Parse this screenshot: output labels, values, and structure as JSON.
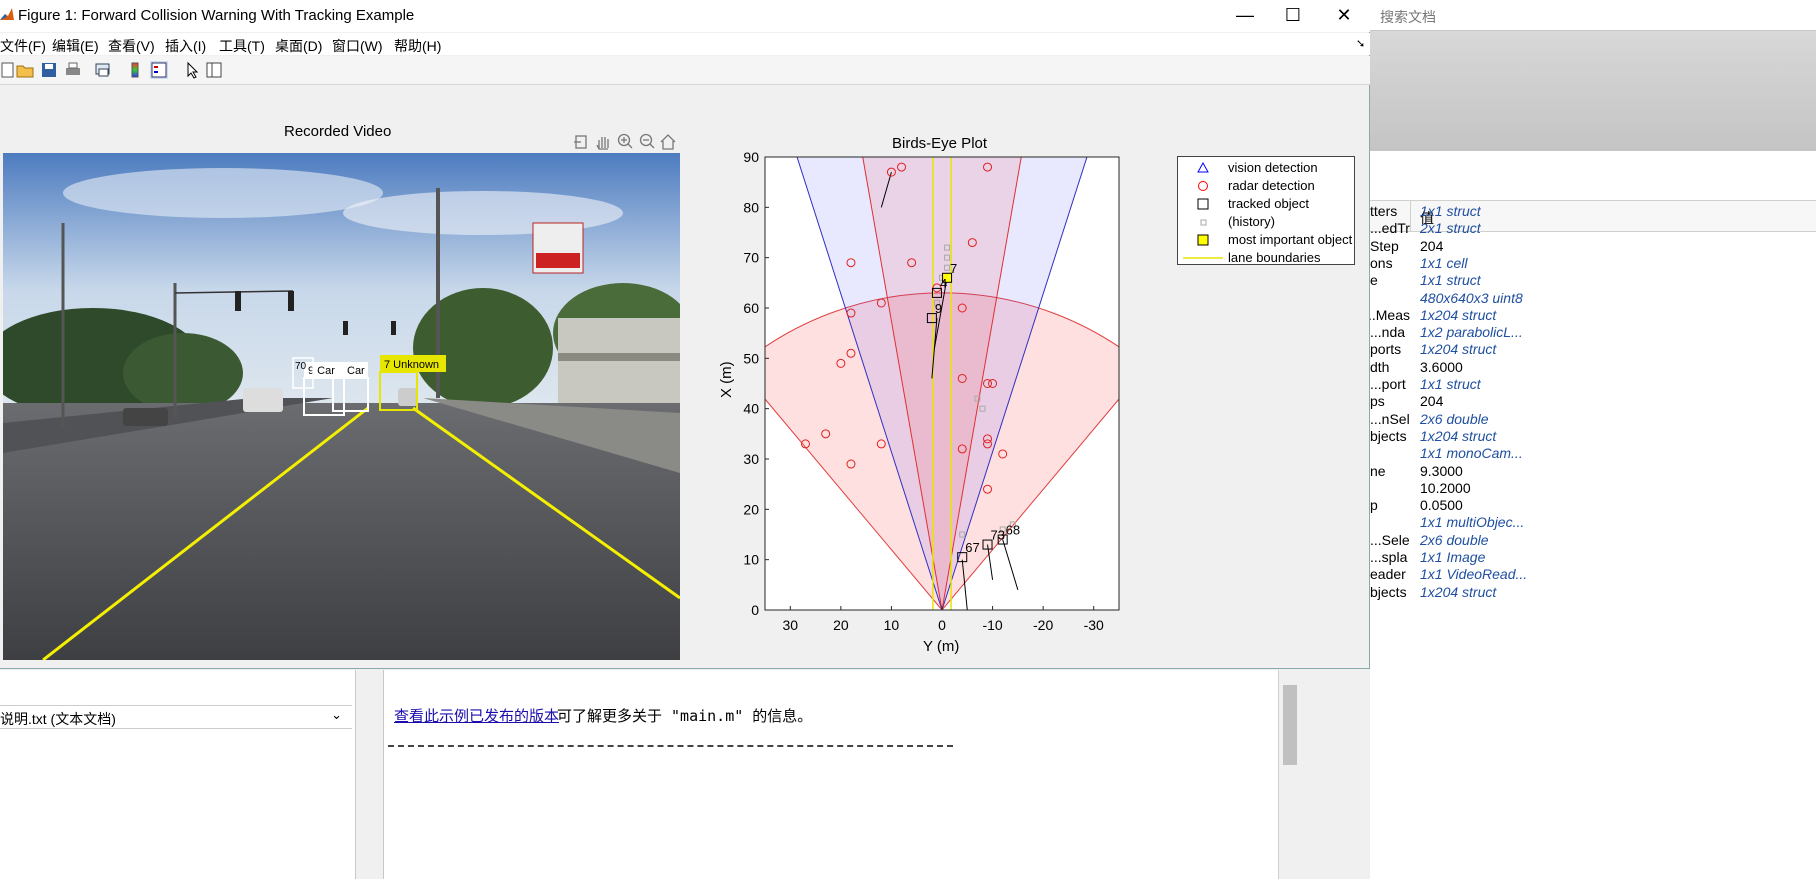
{
  "window": {
    "title": "Figure 1: Forward Collision Warning With Tracking Example",
    "minimize": "—",
    "maximize": "☐",
    "close": "✕"
  },
  "menu": [
    "文件(F)",
    "编辑(E)",
    "查看(V)",
    "插入(I)",
    "工具(T)",
    "桌面(D)",
    "窗口(W)",
    "帮助(H)"
  ],
  "toolbar_icons": [
    "new-figure-icon",
    "open-icon",
    "save-icon",
    "print-icon",
    "link-plot-icon",
    "colorbar-icon",
    "legend-icon",
    "pointer-icon",
    "property-editor-icon"
  ],
  "video_panel": {
    "title": "Recorded Video",
    "axes_tools": [
      "export-icon",
      "pan-hand-icon",
      "zoom-in-icon",
      "zoom-out-icon",
      "home-icon"
    ],
    "detections": [
      {
        "label": "7 Unknown",
        "color": "#e6e600"
      },
      {
        "label": "9 Car",
        "color": "#ffffff"
      },
      {
        "label": "Car",
        "color": "#ffffff"
      },
      {
        "label": "70",
        "color": "#ffffff"
      }
    ]
  },
  "birds_eye": {
    "title": "Birds-Eye Plot",
    "xlabel": "Y (m)",
    "ylabel": "X (m)",
    "xticks": [
      "30",
      "20",
      "10",
      "0",
      "-10",
      "-20",
      "-30"
    ],
    "yticks": [
      "0",
      "10",
      "20",
      "30",
      "40",
      "50",
      "60",
      "70",
      "80",
      "90"
    ],
    "legend": [
      {
        "label": "vision detection",
        "marker": "triangle",
        "color": "#0000ff"
      },
      {
        "label": "radar detection",
        "marker": "circle",
        "color": "#ff0000"
      },
      {
        "label": "tracked object",
        "marker": "square",
        "color": "#000000"
      },
      {
        "label": "(history)",
        "marker": "small-square",
        "color": "#aaaaaa"
      },
      {
        "label": "most important object",
        "marker": "filled-square",
        "color": "#ffff00"
      },
      {
        "label": "lane boundaries",
        "marker": "line",
        "color": "#e6e600"
      }
    ],
    "track_labels": [
      "7",
      "4",
      "9",
      "67",
      "73",
      "68"
    ]
  },
  "chart_data": {
    "type": "scatter",
    "title": "Birds-Eye Plot",
    "xlabel": "Y (m)",
    "ylabel": "X (m)",
    "xlim": [
      35,
      -35
    ],
    "ylim": [
      0,
      90
    ],
    "radar_detections": [
      [
        10,
        87
      ],
      [
        8,
        88
      ],
      [
        18,
        69
      ],
      [
        6,
        69
      ],
      [
        -6,
        73
      ],
      [
        -9,
        88
      ],
      [
        1,
        64
      ],
      [
        12,
        61
      ],
      [
        18,
        59
      ],
      [
        -4,
        60
      ],
      [
        18,
        51
      ],
      [
        20,
        49
      ],
      [
        -4,
        46
      ],
      [
        -9,
        45
      ],
      [
        -10,
        45
      ],
      [
        27,
        33
      ],
      [
        23,
        35
      ],
      [
        12,
        33
      ],
      [
        18,
        29
      ],
      [
        -4,
        32
      ],
      [
        -9,
        34
      ],
      [
        -9,
        33
      ],
      [
        -12,
        31
      ],
      [
        -9,
        24
      ]
    ],
    "tracked_objects": [
      {
        "id": "7",
        "x": 66,
        "y": -1,
        "most_important": true
      },
      {
        "id": "4",
        "x": 63,
        "y": 1
      },
      {
        "id": "9",
        "x": 58,
        "y": 2
      },
      {
        "id": "67",
        "x": 10.5,
        "y": -4
      },
      {
        "id": "73",
        "x": 13,
        "y": -9
      },
      {
        "id": "68",
        "x": 14,
        "y": -12
      }
    ]
  },
  "workspace": {
    "search_placeholder": "搜索文档",
    "value_header": "值",
    "rows": [
      {
        "name": "...tters",
        "value": "1x1 struct",
        "italic": true
      },
      {
        "name": "...edTr...",
        "value": "2x1 struct",
        "italic": true
      },
      {
        "name": "...Step",
        "value": "204",
        "italic": false
      },
      {
        "name": "...ons",
        "value": "1x1 cell",
        "italic": true
      },
      {
        "name": "...e",
        "value": "1x1 struct",
        "italic": true
      },
      {
        "name": "",
        "value": "480x640x3 uint8",
        "italic": true
      },
      {
        "name": "...Meas...",
        "value": "1x204 struct",
        "italic": true
      },
      {
        "name": "...nda...",
        "value": "1x2 parabolicL...",
        "italic": true
      },
      {
        "name": "...ports",
        "value": "1x204 struct",
        "italic": true
      },
      {
        "name": "...dth",
        "value": "3.6000",
        "italic": false
      },
      {
        "name": "...port...",
        "value": "1x1 struct",
        "italic": true
      },
      {
        "name": "...ps",
        "value": "204",
        "italic": false
      },
      {
        "name": "...nSel...",
        "value": "2x6 double",
        "italic": true
      },
      {
        "name": "...bjects",
        "value": "1x204 struct",
        "italic": true
      },
      {
        "name": "",
        "value": "1x1 monoCam...",
        "italic": true
      },
      {
        "name": "...ne",
        "value": "9.3000",
        "italic": false
      },
      {
        "name": "",
        "value": "10.2000",
        "italic": false
      },
      {
        "name": "...p",
        "value": "0.0500",
        "italic": false
      },
      {
        "name": "",
        "value": "1x1 multiObjec...",
        "italic": true
      },
      {
        "name": "...Sele...",
        "value": "2x6 double",
        "italic": true
      },
      {
        "name": "...spla...",
        "value": "1x1 Image",
        "italic": true
      },
      {
        "name": "...eader",
        "value": "1x1 VideoRead...",
        "italic": true
      },
      {
        "name": "...bjects",
        "value": "1x204 struct",
        "italic": true
      }
    ]
  },
  "file_selector": {
    "value": "说明.txt  (文本文档)"
  },
  "doc": {
    "link": "查看此示例已发布的版本",
    "text": "可了解更多关于 \"main.m\" 的信息。"
  }
}
